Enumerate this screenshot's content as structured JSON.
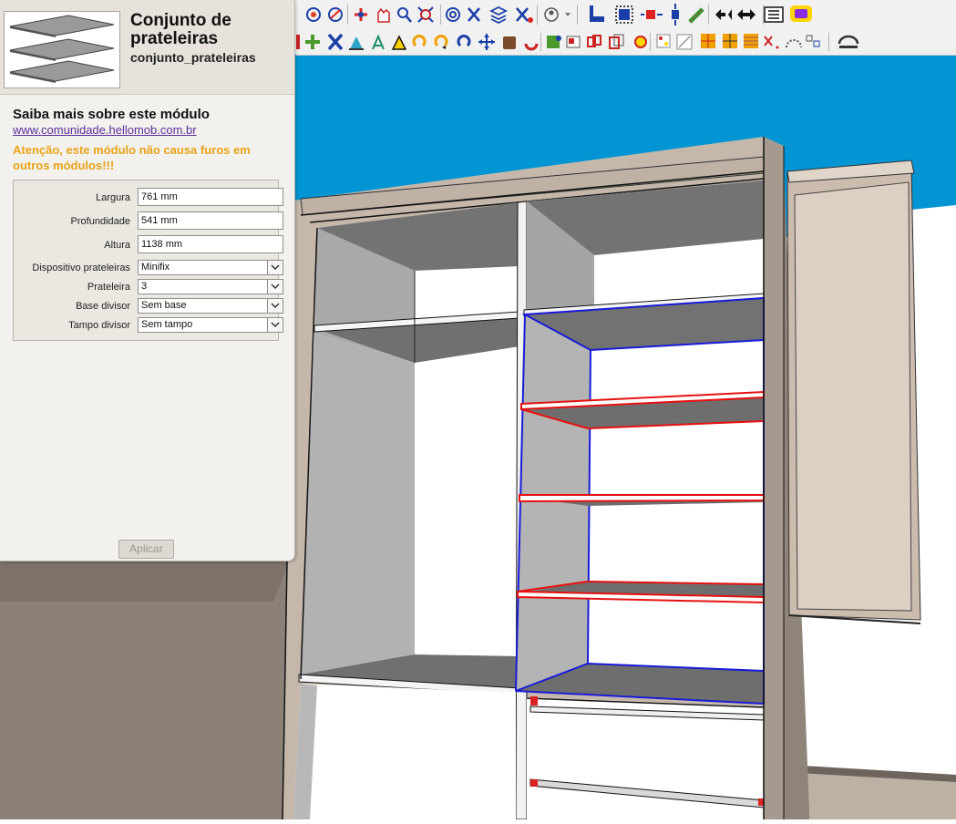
{
  "panel": {
    "title": "Conjunto de prateleiras",
    "module_id": "conjunto_prateleiras",
    "learn_more_title": "Saiba mais sobre este módulo",
    "learn_more_link": "www.comunidade.hellomob.com.br",
    "warning": "Atenção, este módulo não causa furos em outros módulos!!!",
    "fields": [
      {
        "label": "Largura",
        "value": "761 mm"
      },
      {
        "label": "Profundidade",
        "value": "541 mm"
      },
      {
        "label": "Altura",
        "value": "1138 mm"
      }
    ],
    "selects": [
      {
        "label": "Dispositivo prateleiras",
        "value": "Minifix"
      },
      {
        "label": "Prateleira",
        "value": "3"
      },
      {
        "label": "Base divisor",
        "value": "Sem base"
      },
      {
        "label": "Tampo divisor",
        "value": "Sem tampo"
      }
    ],
    "apply_label": "Aplicar"
  },
  "colors": {
    "sky": "#0195d3",
    "selection_blue": "#1a1ad8",
    "selection_red": "#e61010",
    "carcass": "#c5b8ab",
    "warning": "#e8a317",
    "link": "#5a2e9a"
  },
  "toolbar": {
    "row1_icons": [
      "record-icon",
      "paint-icon",
      "flip-icon",
      "hand-icon",
      "magnify-icon",
      "zoom-extents-icon",
      "layers-icon",
      "fold-icon",
      "stack-icon",
      "fold-close-icon",
      "user-icon",
      "dropdown-icon",
      "align-left-icon",
      "select-box-icon",
      "move-red-icon",
      "center-icon",
      "diagonal-icon",
      "arrows-icon",
      "expand-icon",
      "list-icon",
      "comment-icon"
    ],
    "row2_icons": [
      "add-icon",
      "plus-icon",
      "cross-icon",
      "paint-bucket-icon",
      "compass-icon",
      "triangle-icon",
      "rotate-icon",
      "rotate-cw-icon",
      "rotate-ccw-icon",
      "move-icon",
      "cylinder-icon",
      "undo-icon",
      "puzzle-icon",
      "box-icon",
      "cubes-icon",
      "outline-icon",
      "sticker-icon",
      "grid-icon",
      "hatch-icon",
      "gold-grid-icon",
      "dark-grid-icon",
      "scatter-icon",
      "dotted-arc-icon",
      "arrange-icon",
      "curve-icon"
    ]
  }
}
